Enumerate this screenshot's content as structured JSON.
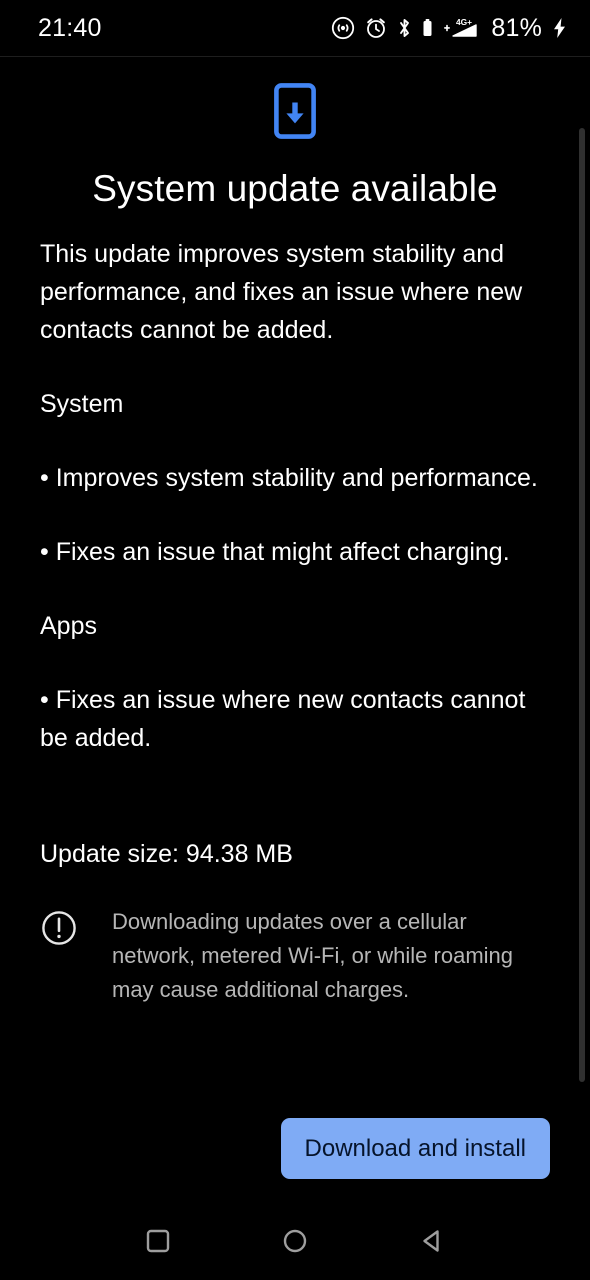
{
  "status_bar": {
    "time": "21:40",
    "battery_percent": "81%",
    "icons": [
      "cast-wireless-icon",
      "alarm-clock-icon",
      "bluetooth-icon",
      "battery-small-icon",
      "mobile-signal-4g-plus-icon",
      "charging-bolt-icon"
    ],
    "network_label": "4G+"
  },
  "screen": {
    "icon": "phone-download-update-icon",
    "title": "System update available",
    "summary": "This update improves system stability and performance, and fixes an issue where new contacts cannot be added.",
    "sections": [
      {
        "heading": "System",
        "bullets": [
          "• Improves system stability and performance.",
          "• Fixes an issue that might affect charging."
        ]
      },
      {
        "heading": "Apps",
        "bullets": [
          "• Fixes an issue where new contacts cannot be added."
        ]
      }
    ],
    "update_size": "Update size: 94.38 MB",
    "warning": {
      "icon": "exclamation-circle-icon",
      "text": "Downloading updates over a cellular network, metered Wi-Fi, or while roaming may cause additional charges."
    },
    "primary_action": "Download and install"
  },
  "nav_bar": {
    "recents_label": "recents-square-icon",
    "home_label": "home-circle-icon",
    "back_label": "back-triangle-icon"
  },
  "colors": {
    "background": "#000000",
    "accent_blue": "#4285f4",
    "button_fill": "#7fabf5",
    "button_text": "#06142b",
    "body_text": "#ffffff",
    "muted_text": "#b6b6b6",
    "scrollbar": "#303030"
  }
}
